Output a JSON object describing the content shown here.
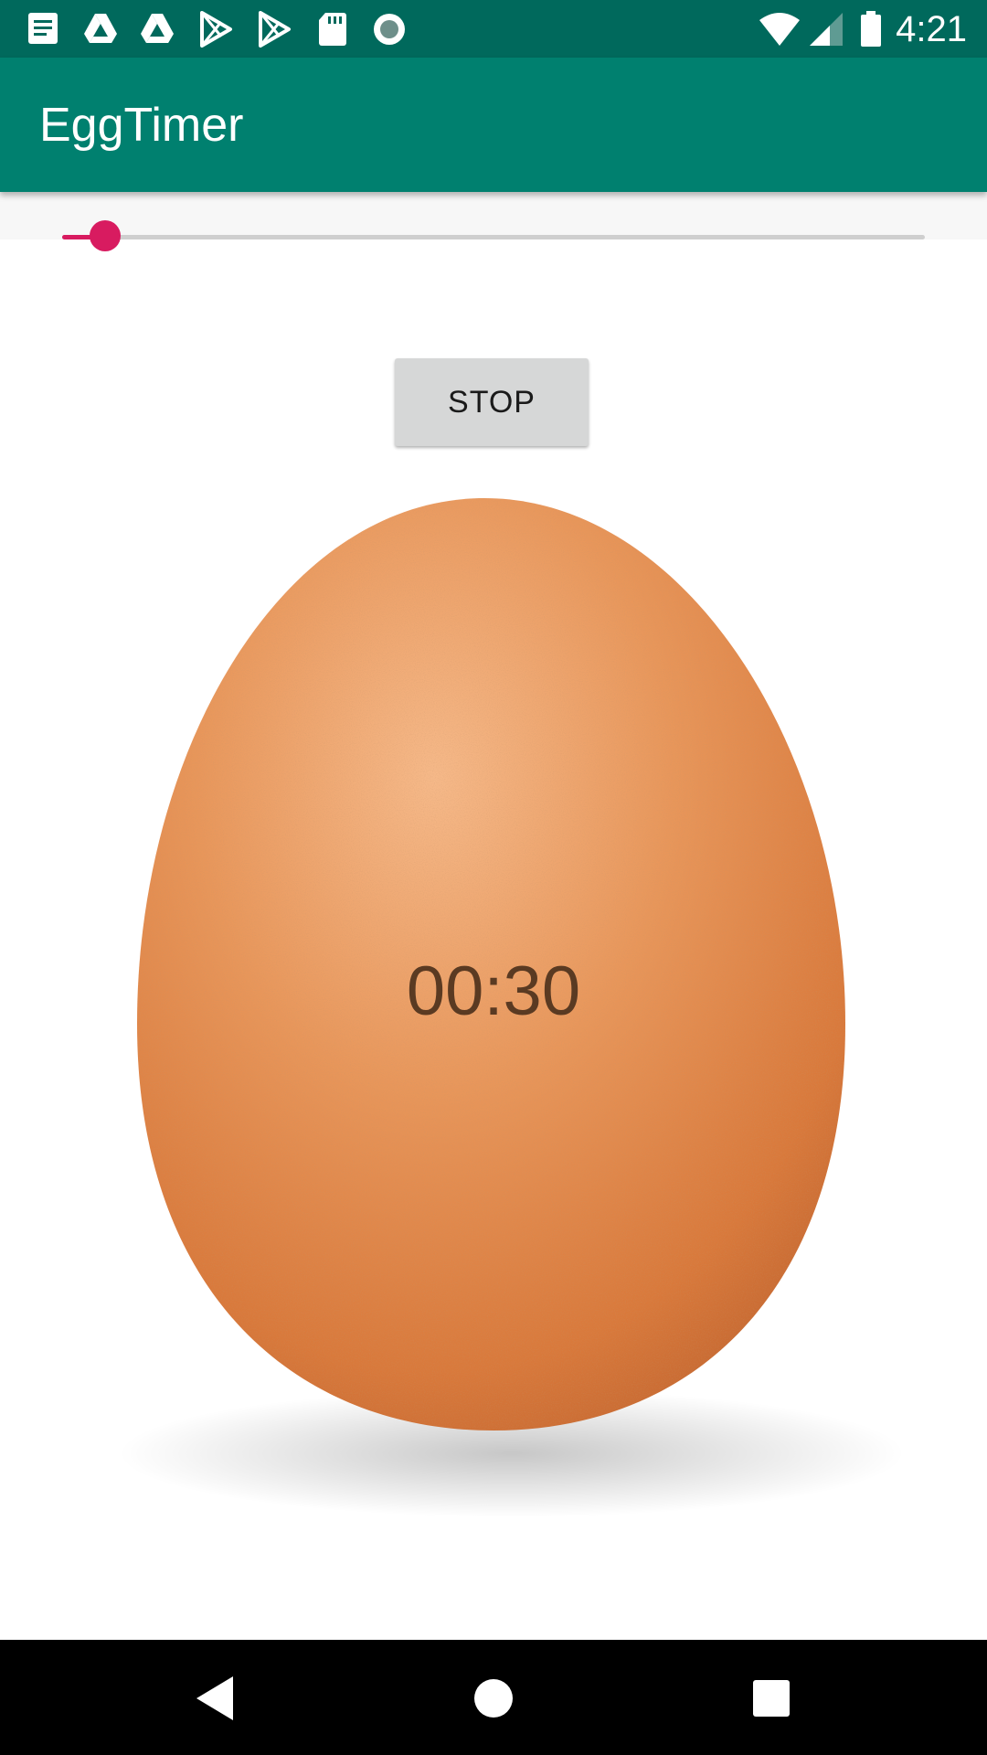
{
  "status_bar": {
    "time": "4:21",
    "left_icons": [
      "notes-icon",
      "drive-icon",
      "drive-icon",
      "play-store-icon",
      "play-store-icon",
      "sd-card-icon",
      "record-icon"
    ],
    "right_icons": [
      "wifi-icon",
      "cell-signal-icon",
      "battery-icon"
    ]
  },
  "app_bar": {
    "title": "EggTimer"
  },
  "slider": {
    "value_fraction": 0.05,
    "accent_color": "#d81b60"
  },
  "stop_button": {
    "label": "STOP"
  },
  "egg": {
    "image_icon": "egg-image"
  },
  "timer": {
    "display": "00:30"
  },
  "nav_bar": {
    "buttons": [
      "back-icon",
      "home-icon",
      "recents-icon"
    ]
  },
  "colors": {
    "status_bar": "#00695c",
    "app_bar": "#00806f",
    "accent": "#d81b60"
  }
}
